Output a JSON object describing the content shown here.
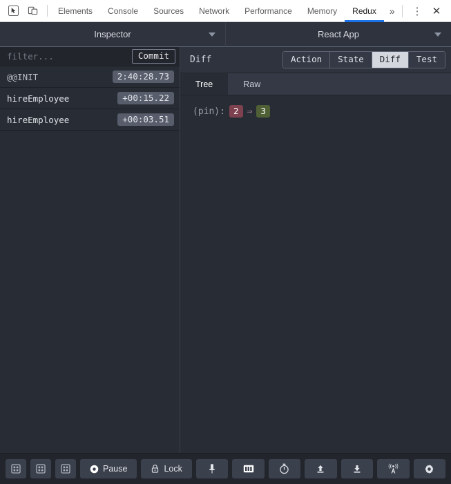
{
  "devtools": {
    "icons": [
      {
        "name": "inspect-element-icon"
      },
      {
        "name": "device-toolbar-icon"
      }
    ],
    "tabs": [
      {
        "label": "Elements",
        "active": false
      },
      {
        "label": "Console",
        "active": false
      },
      {
        "label": "Sources",
        "active": false
      },
      {
        "label": "Network",
        "active": false
      },
      {
        "label": "Performance",
        "active": false
      },
      {
        "label": "Memory",
        "active": false
      },
      {
        "label": "Redux",
        "active": true
      }
    ],
    "more_tabs_label": "»",
    "menu_label": "⋮",
    "close_label": "✕",
    "accent_color": "#1a73e8"
  },
  "panel_header": {
    "monitor_select": {
      "label": "Inspector",
      "caret": "chevron-down-icon"
    },
    "instance_select": {
      "label": "React App",
      "caret": "chevron-down-icon"
    }
  },
  "left_pane": {
    "filter": {
      "placeholder": "filter...",
      "value": ""
    },
    "commit_label": "Commit",
    "actions": [
      {
        "name": "@@INIT",
        "time": "2:40:28.73",
        "is_init": true
      },
      {
        "name": "hireEmployee",
        "time": "+00:15.22",
        "is_init": false
      },
      {
        "name": "hireEmployee",
        "time": "+00:03.51",
        "is_init": false
      }
    ]
  },
  "right_pane": {
    "title": "Diff",
    "segments": [
      {
        "label": "Action",
        "active": false
      },
      {
        "label": "State",
        "active": false
      },
      {
        "label": "Diff",
        "active": true
      },
      {
        "label": "Test",
        "active": false
      }
    ],
    "subtabs": [
      {
        "label": "Tree",
        "active": true
      },
      {
        "label": "Raw",
        "active": false
      }
    ],
    "diff": {
      "key": "(pin):",
      "old_value": "2",
      "arrow": "⇒",
      "new_value": "3",
      "old_color": "#7e414f",
      "new_color": "#4f6036"
    }
  },
  "bottom_bar": {
    "buttons": [
      {
        "name": "layout-one-icon",
        "label": "",
        "icon": "grid",
        "type": "square"
      },
      {
        "name": "layout-two-icon",
        "label": "",
        "icon": "grid",
        "type": "square"
      },
      {
        "name": "layout-three-icon",
        "label": "",
        "icon": "grid",
        "type": "square"
      },
      {
        "name": "pause-button",
        "label": "Pause",
        "icon": "record",
        "type": "wide"
      },
      {
        "name": "lock-button",
        "label": "Lock",
        "icon": "lock",
        "type": "wide"
      },
      {
        "name": "pin-button",
        "label": "",
        "icon": "pin",
        "type": "flexible"
      },
      {
        "name": "dispatcher-button",
        "label": "",
        "icon": "dispatch",
        "type": "flexible"
      },
      {
        "name": "slider-monitor-button",
        "label": "",
        "icon": "timer",
        "type": "flexible"
      },
      {
        "name": "import-button",
        "label": "",
        "icon": "upload",
        "type": "flexible"
      },
      {
        "name": "export-button",
        "label": "",
        "icon": "download",
        "type": "flexible"
      },
      {
        "name": "remote-button",
        "label": "",
        "icon": "broadcast",
        "type": "flexible"
      },
      {
        "name": "settings-button",
        "label": "",
        "icon": "gear",
        "type": "flexible"
      }
    ]
  }
}
